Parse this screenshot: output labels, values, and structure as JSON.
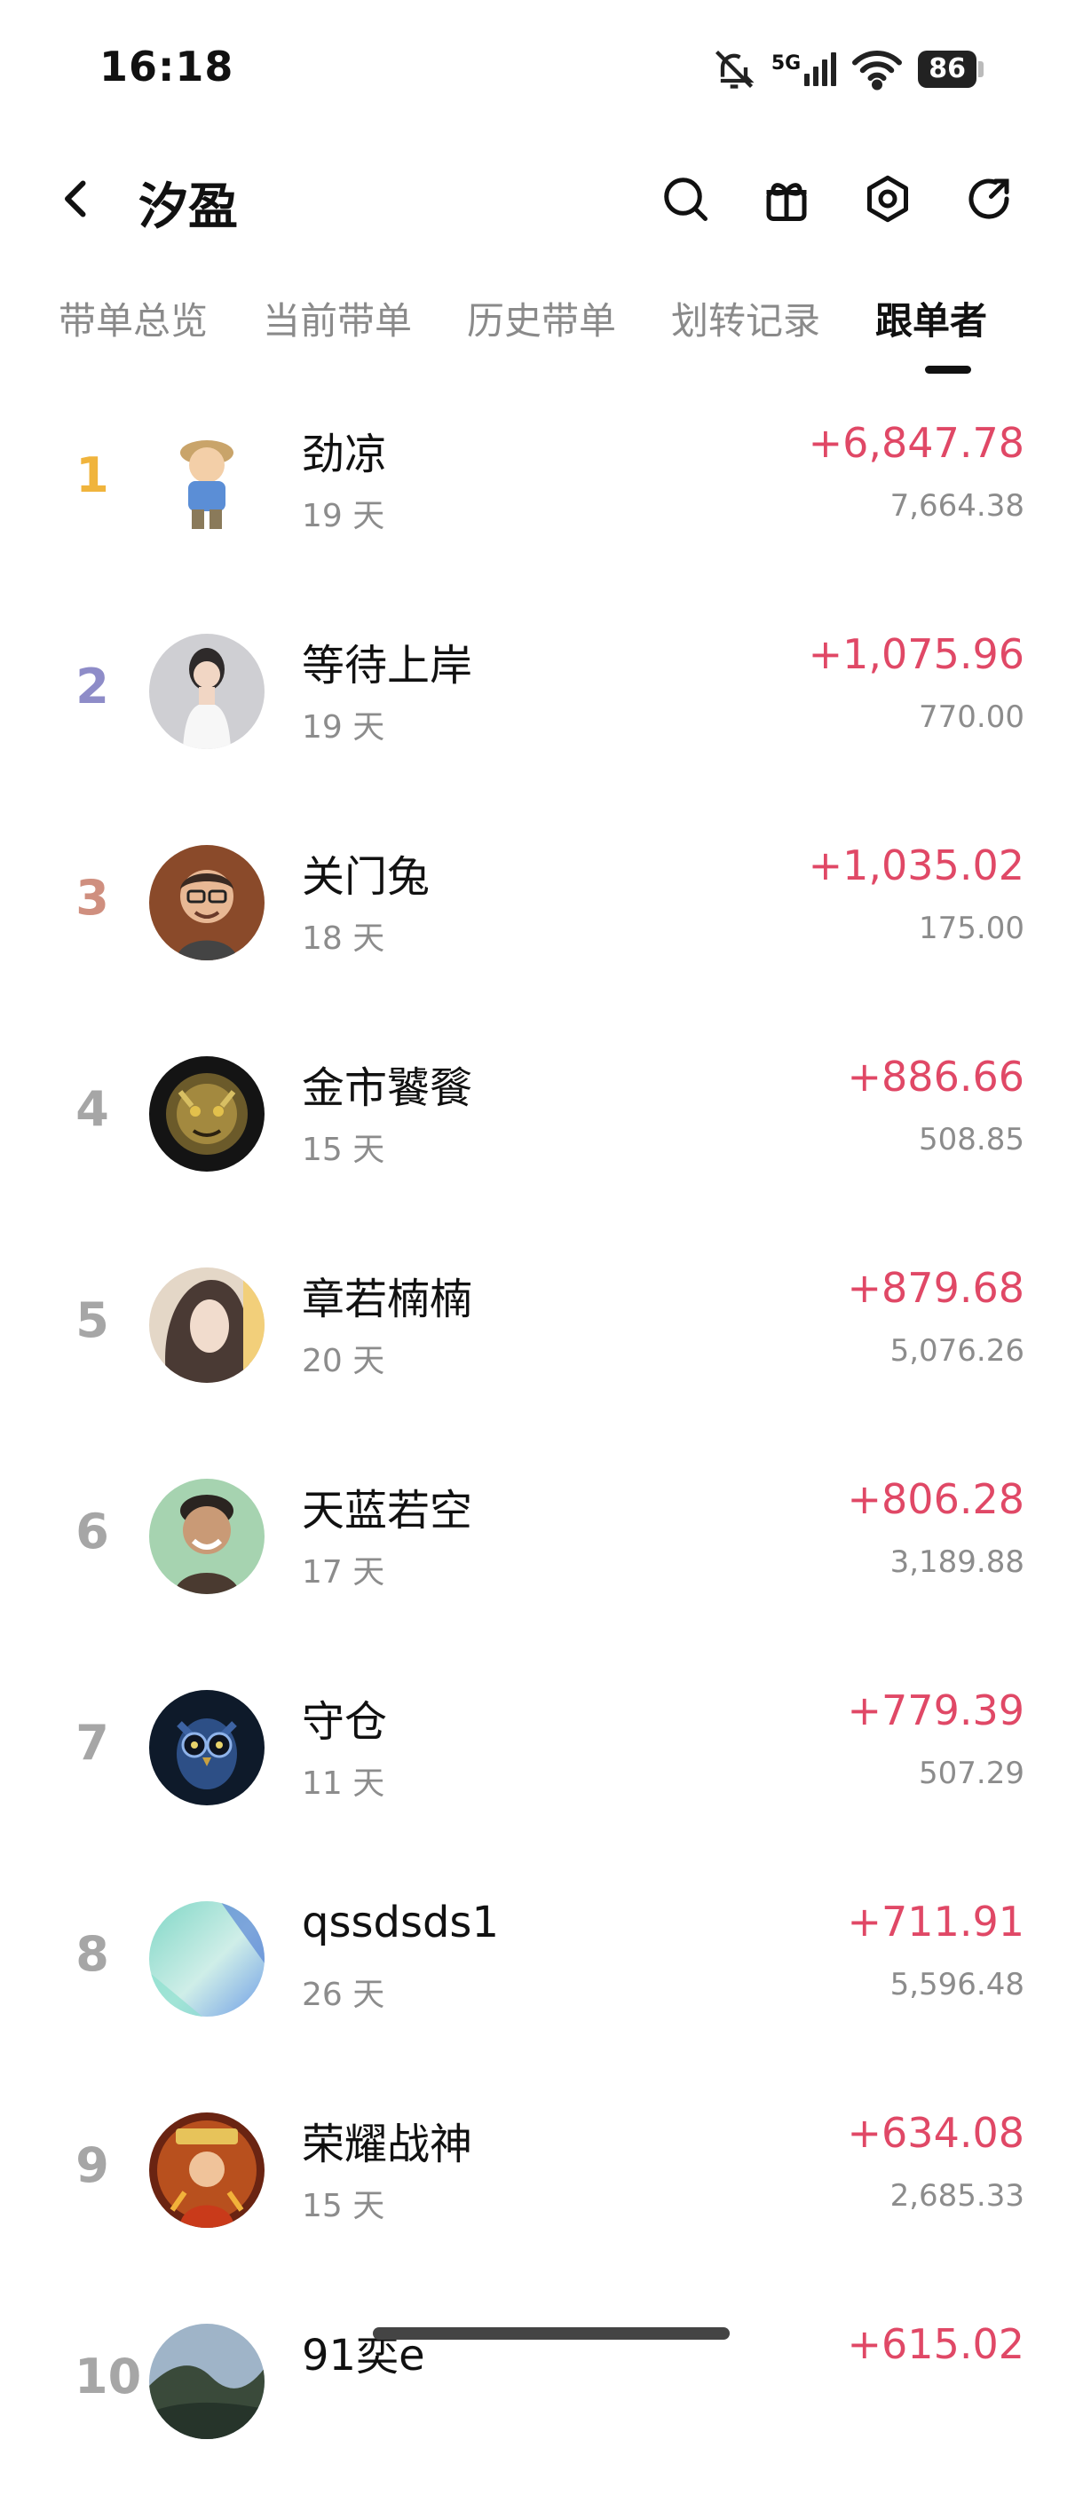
{
  "status_bar": {
    "time": "16:18",
    "network": "5G",
    "battery": "86",
    "icons": [
      "bell-muted-icon",
      "signal-icon",
      "wifi-icon",
      "battery-icon"
    ]
  },
  "header": {
    "title": "汐盈",
    "icons": [
      "back-icon",
      "search-icon",
      "gift-icon",
      "settings-icon",
      "share-icon"
    ]
  },
  "tabs": [
    {
      "label": "带单总览",
      "active": false
    },
    {
      "label": "当前带单",
      "active": false
    },
    {
      "label": "历史带单",
      "active": false
    },
    {
      "label": "划转记录",
      "active": false
    },
    {
      "label": "跟单者",
      "active": true
    }
  ],
  "colors": {
    "profit": "#e04866",
    "rank_1": "#f0b43c",
    "rank_2": "#8e8cc8",
    "rank_3": "#cf8f7f",
    "rank_other": "#a6a6a6"
  },
  "followers": [
    {
      "rank": "1",
      "name": "劲凉",
      "days": "19 天",
      "profit": "+6,847.78",
      "amount": "7,664.38",
      "avatar": "cartoon-boy-avatar"
    },
    {
      "rank": "2",
      "name": "等待上岸",
      "days": "19 天",
      "profit": "+1,075.96",
      "amount": "770.00",
      "avatar": "woman-photo-avatar"
    },
    {
      "rank": "3",
      "name": "关门兔",
      "days": "18 天",
      "profit": "+1,035.02",
      "amount": "175.00",
      "avatar": "man-glasses-avatar"
    },
    {
      "rank": "4",
      "name": "金市饕餮",
      "days": "15 天",
      "profit": "+886.66",
      "amount": "508.85",
      "avatar": "gold-beast-avatar"
    },
    {
      "rank": "5",
      "name": "章若楠楠",
      "days": "20 天",
      "profit": "+879.68",
      "amount": "5,076.26",
      "avatar": "girl-portrait-avatar"
    },
    {
      "rank": "6",
      "name": "天蓝若空",
      "days": "17 天",
      "profit": "+806.28",
      "amount": "3,189.88",
      "avatar": "smiling-man-avatar"
    },
    {
      "rank": "7",
      "name": "守仓",
      "days": "11 天",
      "profit": "+779.39",
      "amount": "507.29",
      "avatar": "owl-avatar"
    },
    {
      "rank": "8",
      "name": "qssdsds1",
      "days": "26 天",
      "profit": "+711.91",
      "amount": "5,596.48",
      "avatar": "abstract-teal-avatar"
    },
    {
      "rank": "9",
      "name": "荣耀战神",
      "days": "15 天",
      "profit": "+634.08",
      "amount": "2,685.33",
      "avatar": "war-god-avatar"
    },
    {
      "rank": "10",
      "name": "91奕e",
      "days": "",
      "profit": "+615.02",
      "amount": "",
      "avatar": "landscape-avatar"
    }
  ]
}
